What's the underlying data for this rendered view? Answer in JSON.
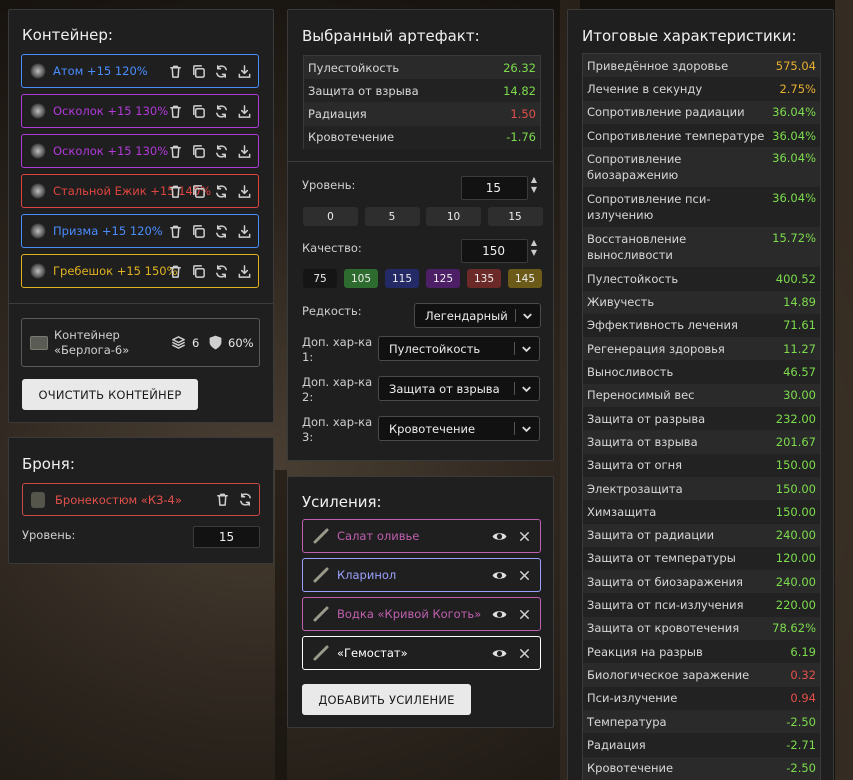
{
  "container_panel": {
    "title": "Контейнер:",
    "items": [
      {
        "label": "Атом +15 120%",
        "color": "#4a8dff"
      },
      {
        "label": "Осколок +15 130%",
        "color": "#b23ad9"
      },
      {
        "label": "Осколок +15 130%",
        "color": "#b23ad9"
      },
      {
        "label": "Стальной Ежик +15 140%",
        "color": "#e0443f"
      },
      {
        "label": "Призма +15 120%",
        "color": "#4a8dff"
      },
      {
        "label": "Гребешок +15 150%",
        "color": "#e0b321"
      }
    ],
    "container": {
      "label": "Контейнер «Берлога-6»",
      "slots": "6",
      "protection": "60%"
    },
    "clear_button": "ОЧИСТИТЬ КОНТЕЙНЕР"
  },
  "armor_panel": {
    "title": "Броня:",
    "item_label": "Бронекостюм «КЗ-4»",
    "level_label": "Уровень:",
    "level_value": "15"
  },
  "artifact_panel": {
    "title": "Выбранный артефакт:",
    "stats": [
      {
        "name": "Пулестойкость",
        "value": "26.32",
        "color": "#7ddc4d"
      },
      {
        "name": "Защита от взрыва",
        "value": "14.82",
        "color": "#7ddc4d"
      },
      {
        "name": "Радиация",
        "value": "1.50",
        "color": "#e2504b"
      },
      {
        "name": "Кровотечение",
        "value": "-1.76",
        "color": "#7ddc4d"
      }
    ],
    "level_label": "Уровень:",
    "level_value": "15",
    "level_presets": [
      "0",
      "5",
      "10",
      "15"
    ],
    "quality_label": "Качество:",
    "quality_value": "150",
    "quality_presets": [
      {
        "label": "75",
        "color": "#151515"
      },
      {
        "label": "105",
        "color": "#2e6b2e"
      },
      {
        "label": "115",
        "color": "#242a66"
      },
      {
        "label": "125",
        "color": "#4c1f66"
      },
      {
        "label": "135",
        "color": "#6b2a28"
      },
      {
        "label": "145",
        "color": "#6b5a18"
      }
    ],
    "rarity_label": "Редкость:",
    "rarity_value": "Легендарный",
    "extra_label": "Доп. хар-ка",
    "extras": [
      {
        "num": "1:",
        "value": "Пулестойкость"
      },
      {
        "num": "2:",
        "value": "Защита от взрыва"
      },
      {
        "num": "3:",
        "value": "Кровотечение"
      }
    ]
  },
  "boosts_panel": {
    "title": "Усиления:",
    "items": [
      {
        "label": "Салат оливье",
        "color": "#c05fb0",
        "icon": "salad-icon"
      },
      {
        "label": "Кларинол",
        "color": "#9aa0ff",
        "icon": "syringe-icon"
      },
      {
        "label": "Водка «Кривой Коготь»",
        "color": "#c05fb0",
        "icon": "bottle-icon"
      },
      {
        "label": "«Гемостат»",
        "color": "#ffffff",
        "icon": "injector-icon"
      }
    ],
    "add_button": "ДОБАВИТЬ УСИЛЕНИЕ"
  },
  "totals_panel": {
    "title": "Итоговые характеристики:",
    "stats": [
      {
        "name": "Приведённое здоровье",
        "value": "575.04",
        "color": "#e6b030"
      },
      {
        "name": "Лечение в секунду",
        "value": "2.75%",
        "color": "#e6b030"
      },
      {
        "name": "Сопротивление радиации",
        "value": "36.04%",
        "color": "#7ddc4d"
      },
      {
        "name": "Сопротивление температуре",
        "value": "36.04%",
        "color": "#7ddc4d"
      },
      {
        "name": "Сопротивление биозаражению",
        "value": "36.04%",
        "color": "#7ddc4d",
        "two_line": true
      },
      {
        "name": "Сопротивление пси-излучению",
        "value": "36.04%",
        "color": "#7ddc4d",
        "two_line": true
      },
      {
        "name": "Восстановление выносливости",
        "value": "15.72%",
        "color": "#7ddc4d",
        "two_line": true
      },
      {
        "name": "Пулестойкость",
        "value": "400.52",
        "color": "#7ddc4d"
      },
      {
        "name": "Живучесть",
        "value": "14.89",
        "color": "#7ddc4d"
      },
      {
        "name": "Эффективность лечения",
        "value": "71.61",
        "color": "#7ddc4d"
      },
      {
        "name": "Регенерация здоровья",
        "value": "11.27",
        "color": "#7ddc4d"
      },
      {
        "name": "Выносливость",
        "value": "46.57",
        "color": "#7ddc4d"
      },
      {
        "name": "Переносимый вес",
        "value": "30.00",
        "color": "#7ddc4d"
      },
      {
        "name": "Защита от разрыва",
        "value": "232.00",
        "color": "#7ddc4d"
      },
      {
        "name": "Защита от взрыва",
        "value": "201.67",
        "color": "#7ddc4d"
      },
      {
        "name": "Защита от огня",
        "value": "150.00",
        "color": "#7ddc4d"
      },
      {
        "name": "Электрозащита",
        "value": "150.00",
        "color": "#7ddc4d"
      },
      {
        "name": "Химзащита",
        "value": "150.00",
        "color": "#7ddc4d"
      },
      {
        "name": "Защита от радиации",
        "value": "240.00",
        "color": "#7ddc4d"
      },
      {
        "name": "Защита от температуры",
        "value": "120.00",
        "color": "#7ddc4d"
      },
      {
        "name": "Защита от биозаражения",
        "value": "240.00",
        "color": "#7ddc4d"
      },
      {
        "name": "Защита от пси-излучения",
        "value": "220.00",
        "color": "#7ddc4d"
      },
      {
        "name": "Защита от кровотечения",
        "value": "78.62%",
        "color": "#7ddc4d"
      },
      {
        "name": "Реакция на разрыв",
        "value": "6.19",
        "color": "#7ddc4d"
      },
      {
        "name": "Биологическое заражение",
        "value": "0.32",
        "color": "#e2504b"
      },
      {
        "name": "Пси-излучение",
        "value": "0.94",
        "color": "#e2504b"
      },
      {
        "name": "Температура",
        "value": "-2.50",
        "color": "#7ddc4d"
      },
      {
        "name": "Радиация",
        "value": "-2.71",
        "color": "#7ddc4d"
      },
      {
        "name": "Кровотечение",
        "value": "-2.50",
        "color": "#7ddc4d"
      }
    ]
  }
}
